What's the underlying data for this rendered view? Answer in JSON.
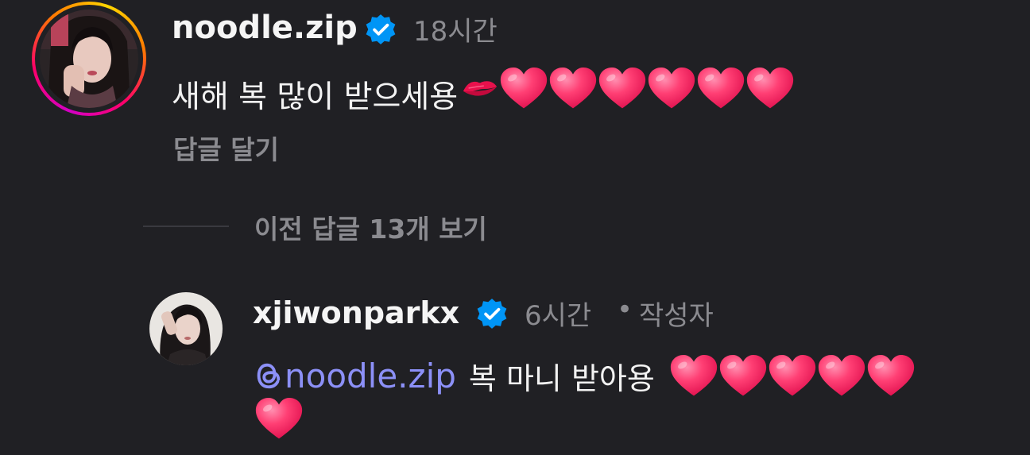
{
  "comment": {
    "username": "noodle.zip",
    "verified_icon": "verified-badge-icon",
    "timestamp": "18시간",
    "text": "새해 복 많이 받으세용",
    "emojis": [
      "kiss-mark-icon",
      "heart-icon",
      "heart-icon",
      "heart-icon",
      "heart-icon",
      "heart-icon",
      "heart-icon"
    ],
    "reply_label": "답글 달기"
  },
  "thread": {
    "view_previous_replies": "이전 답글 13개 보기"
  },
  "reply": {
    "username": "xjiwonparkx",
    "verified_icon": "verified-badge-icon",
    "timestamp": "6시간",
    "separator": "•",
    "author_badge": "작성자",
    "mention_icon": "threads-at-icon",
    "mention": "noodle.zip",
    "text": "복 마니 받아용",
    "emojis": [
      "heart-icon",
      "heart-icon",
      "heart-icon",
      "heart-icon",
      "heart-icon",
      "heart-icon"
    ]
  },
  "colors": {
    "background": "#202024",
    "muted_text": "#8b8b90",
    "mention": "#8c90f7",
    "verified": "#0095f6",
    "heart": "#ff2d6b"
  }
}
